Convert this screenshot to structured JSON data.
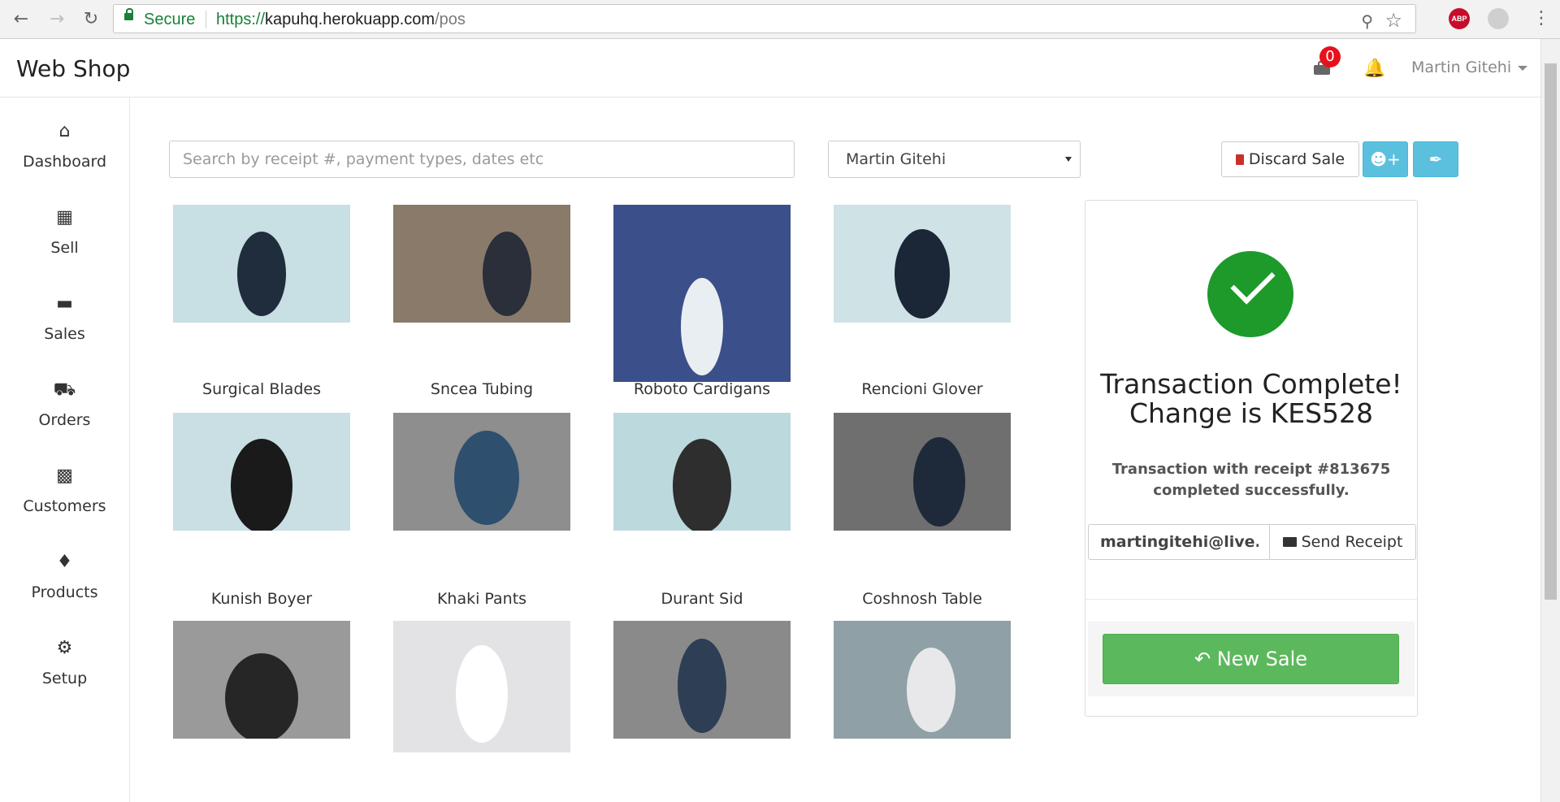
{
  "browser": {
    "secure_label": "Secure",
    "url_protocol": "https://",
    "url_host": "kapuhq.herokuapp.com",
    "url_path": "/pos",
    "extension_label": "ABP"
  },
  "header": {
    "brand": "Web Shop",
    "cart_count": "0",
    "user_name": "Martin Gitehi"
  },
  "sidebar": {
    "items": [
      {
        "label": "Dashboard",
        "icon": "home-icon"
      },
      {
        "label": "Sell",
        "icon": "calculator-icon"
      },
      {
        "label": "Sales",
        "icon": "credit-card-icon"
      },
      {
        "label": "Orders",
        "icon": "truck-icon"
      },
      {
        "label": "Customers",
        "icon": "address-book-icon"
      },
      {
        "label": "Products",
        "icon": "tags-icon"
      },
      {
        "label": "Setup",
        "icon": "gears-icon"
      }
    ]
  },
  "toolbar": {
    "search_placeholder": "Search by receipt #, payment types, dates etc",
    "customer_selected": "Martin Gitehi",
    "discard_label": "Discard Sale"
  },
  "products": [
    {
      "name": "Surgical Blades",
      "bg": "#c8dfe3",
      "fg": "#1f2d3d"
    },
    {
      "name": "Sncea Tubing",
      "bg": "#8a7a6a",
      "fg": "#2a2f3a"
    },
    {
      "name": "Roboto Cardigans",
      "bg": "#3b4f8a",
      "fg": "#e9eef2"
    },
    {
      "name": "Rencioni Glover",
      "bg": "#cfe2e6",
      "fg": "#1b2636"
    },
    {
      "name": "Kunish Boyer",
      "bg": "#c9dfe3",
      "fg": "#1a1a1a"
    },
    {
      "name": "Khaki Pants",
      "bg": "#8e8e8e",
      "fg": "#2f4f6f"
    },
    {
      "name": "Durant Sid",
      "bg": "#bcd9de",
      "fg": "#2e2e2e"
    },
    {
      "name": "Coshnosh Table",
      "bg": "#6f6f6f",
      "fg": "#1e2a3a"
    },
    {
      "name": "",
      "bg": "#9a9a9a",
      "fg": "#262626"
    },
    {
      "name": "",
      "bg": "#e3e3e5",
      "fg": "#ffffff"
    },
    {
      "name": "",
      "bg": "#8a8a8a",
      "fg": "#2d3e55"
    },
    {
      "name": "",
      "bg": "#8fa1a6",
      "fg": "#e8e8ea"
    }
  ],
  "transaction": {
    "title_line1": "Transaction Complete!",
    "title_line2": "Change is KES528",
    "message": "Transaction with receipt #813675 completed successfully.",
    "email_value": "martingitehi@live.com",
    "send_label": "Send Receipt",
    "new_sale_label": "New Sale"
  },
  "colors": {
    "success_green": "#1d9a2a",
    "new_sale_green": "#5cb85c",
    "info_blue": "#5bc0de",
    "badge_red": "#e8101a"
  }
}
